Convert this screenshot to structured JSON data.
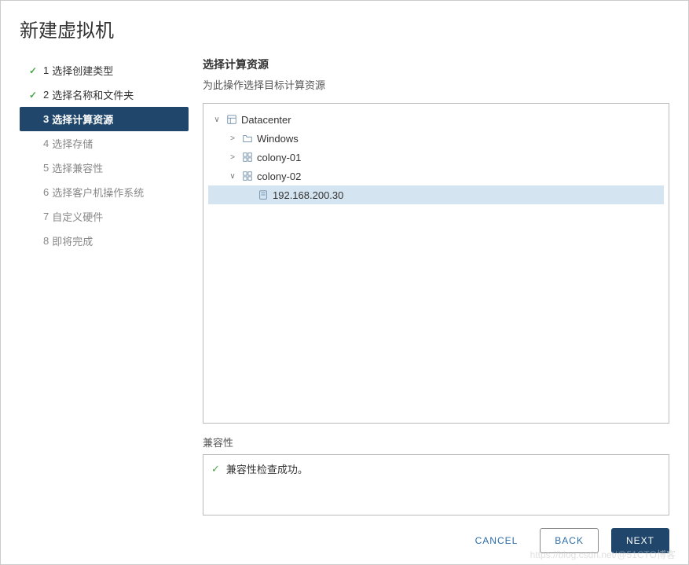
{
  "dialog": {
    "title": "新建虚拟机"
  },
  "steps": [
    {
      "num": "1",
      "label": "选择创建类型",
      "state": "done"
    },
    {
      "num": "2",
      "label": "选择名称和文件夹",
      "state": "done"
    },
    {
      "num": "3",
      "label": "选择计算资源",
      "state": "active"
    },
    {
      "num": "4",
      "label": "选择存储",
      "state": "pending"
    },
    {
      "num": "5",
      "label": "选择兼容性",
      "state": "pending"
    },
    {
      "num": "6",
      "label": "选择客户机操作系统",
      "state": "pending"
    },
    {
      "num": "7",
      "label": "自定义硬件",
      "state": "pending"
    },
    {
      "num": "8",
      "label": "即将完成",
      "state": "pending"
    }
  ],
  "panel": {
    "title": "选择计算资源",
    "subtitle": "为此操作选择目标计算资源"
  },
  "tree": [
    {
      "id": "dc",
      "indent": 0,
      "toggle": "open",
      "icon": "datacenter",
      "label": "Datacenter",
      "selected": false
    },
    {
      "id": "win",
      "indent": 1,
      "toggle": "closed",
      "icon": "folder",
      "label": "Windows",
      "selected": false
    },
    {
      "id": "c01",
      "indent": 1,
      "toggle": "closed",
      "icon": "cluster",
      "label": "colony-01",
      "selected": false
    },
    {
      "id": "c02",
      "indent": 1,
      "toggle": "open",
      "icon": "cluster",
      "label": "colony-02",
      "selected": false
    },
    {
      "id": "host",
      "indent": 2,
      "toggle": "none",
      "icon": "host",
      "label": "192.168.200.30",
      "selected": true
    }
  ],
  "compat": {
    "title": "兼容性",
    "message": "兼容性检查成功。"
  },
  "footer": {
    "cancel": "CANCEL",
    "back": "BACK",
    "next": "NEXT"
  },
  "watermark": "https://blog.csdn.net/@51CTO博客"
}
